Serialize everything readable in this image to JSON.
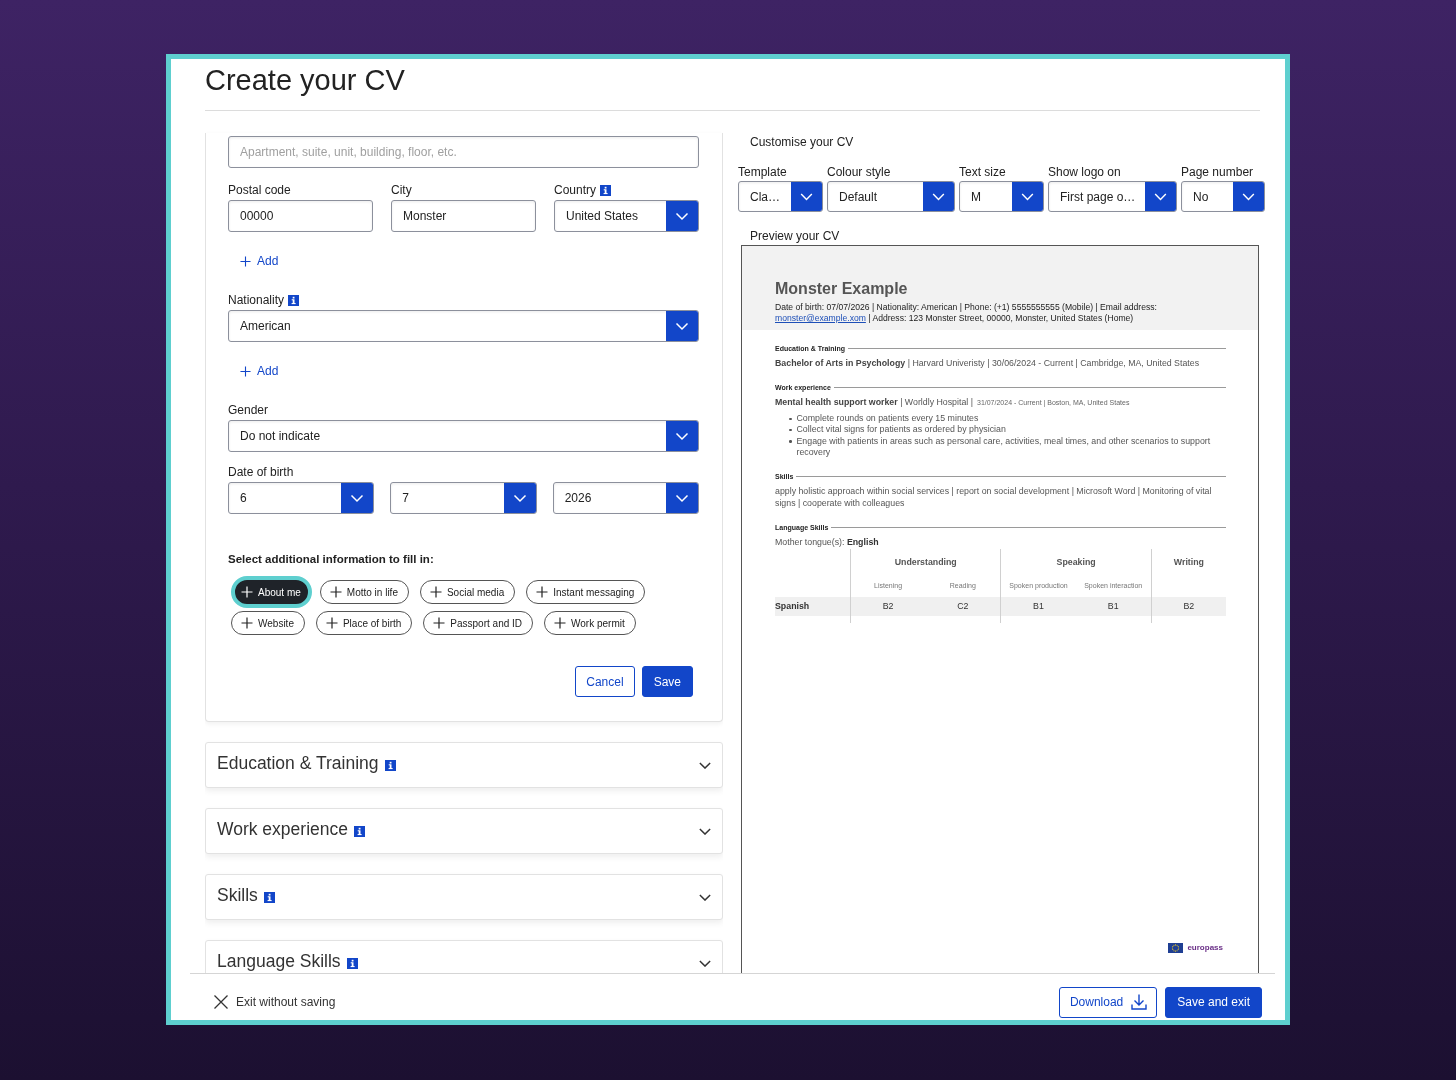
{
  "page": {
    "title": "Create your CV"
  },
  "form": {
    "blocks": [
      {
        "kind": "input",
        "placeholder": "Apartment, suite, unit, building, floor, etc."
      },
      {
        "kind": "fields",
        "fields": [
          {
            "kind": "text",
            "label": "Postal code",
            "info": false,
            "value": "00000"
          },
          {
            "kind": "text",
            "label": "City",
            "info": false,
            "value": "Monster"
          },
          {
            "kind": "select",
            "label": "Country",
            "info": true,
            "value": "United States"
          }
        ]
      },
      {
        "kind": "add",
        "label": "Add"
      },
      {
        "kind": "fields",
        "fields": [
          {
            "kind": "select",
            "label": "Nationality",
            "info": true,
            "value": "American"
          }
        ]
      },
      {
        "kind": "add",
        "label": "Add"
      },
      {
        "kind": "fields",
        "fields": [
          {
            "kind": "select",
            "label": "Gender",
            "info": false,
            "value": "Do not indicate"
          }
        ]
      },
      {
        "kind": "date",
        "label": "Date of birth",
        "fields": [
          {
            "kind": "select",
            "value": "6"
          },
          {
            "kind": "select",
            "value": "7"
          },
          {
            "kind": "select",
            "value": "2026"
          }
        ]
      }
    ],
    "additional": {
      "heading": "Select additional information to fill in:",
      "chips": [
        {
          "label": "About me",
          "selected": true
        },
        {
          "label": "Motto in life",
          "selected": false
        },
        {
          "label": "Social media",
          "selected": false
        },
        {
          "label": "Instant messaging",
          "selected": false
        },
        {
          "label": "Website",
          "selected": false
        },
        {
          "label": "Place of birth",
          "selected": false
        },
        {
          "label": "Passport and ID",
          "selected": false
        },
        {
          "label": "Work permit",
          "selected": false
        }
      ]
    },
    "buttons": [
      {
        "kind": "secondary",
        "label": "Cancel"
      },
      {
        "kind": "primary",
        "label": "Save"
      }
    ]
  },
  "sections": [
    {
      "title": "Education & Training",
      "info": true,
      "expanded": false
    },
    {
      "title": "Work experience",
      "info": true,
      "expanded": false
    },
    {
      "title": "Skills",
      "info": true,
      "expanded": false
    },
    {
      "title": "Language Skills",
      "info": true,
      "expanded": false
    }
  ],
  "customise": {
    "heading": "Customise your CV",
    "options": [
      {
        "label": "Template",
        "value": "Cla…"
      },
      {
        "label": "Colour style",
        "value": "Default"
      },
      {
        "label": "Text size",
        "value": "M"
      },
      {
        "label": "Show logo on",
        "value": "First page o…"
      },
      {
        "label": "Page number",
        "value": "No"
      }
    ]
  },
  "preview": {
    "heading": "Preview your CV",
    "document": {
      "name": "Monster Example",
      "contact": {
        "before": "Date of birth: 07/07/2026 | Nationality: American | Phone: (+1) 5555555555 (Mobile) | Email address:",
        "email": "monster@example.xom",
        "after": "| Address: 123 Monster Street, 00000, Monster, United States (Home)"
      },
      "sections": [
        {
          "kind": "entries",
          "heading": "Education & Training",
          "entries": [
            {
              "headline": "**Bachelor of Arts in Psychology** | Harvard Univeristy | 30/06/2024 - Current | Cambridge, MA, United States"
            }
          ]
        },
        {
          "kind": "entries",
          "heading": "Work experience",
          "entries": [
            {
              "headline": "**Mental health support worker** | Worldly Hospital |",
              "details": "31/07/2024 - Current | Boston, MA, United States",
              "bullets": [
                "Complete rounds on patients every 15 minutes",
                "Collect vital signs for patients as ordered by physician",
                "Engage with patients in areas such as personal care, activities, meal times, and other scenarios to support recovery"
              ]
            }
          ]
        },
        {
          "kind": "text",
          "heading": "Skills",
          "text": "apply holistic approach within social services | report on social development | Microsoft Word | Monitoring of vital signs | cooperate with colleagues"
        },
        {
          "kind": "languages",
          "heading": "Language Skills",
          "mother_tongue": "Mother tongue(s): **English**",
          "table": {
            "groups": [
              {
                "label": "Understanding",
                "columns": [
                  "Listening",
                  "Reading"
                ]
              },
              {
                "label": "Speaking",
                "columns": [
                  "Spoken production",
                  "Spoken interaction"
                ]
              },
              {
                "label": "Writing"
              }
            ],
            "rows": [
              {
                "language": "Spanish",
                "levels": [
                  "B2",
                  "C2",
                  "B1",
                  "B1",
                  "B2"
                ]
              }
            ]
          }
        }
      ],
      "logo": "europass"
    }
  },
  "footer": {
    "exit": "Exit without saving",
    "buttons": [
      {
        "kind": "download",
        "label": "Download"
      },
      {
        "kind": "primary",
        "label": "Save and exit"
      }
    ]
  }
}
